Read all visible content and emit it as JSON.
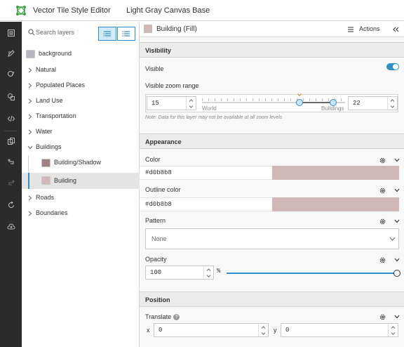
{
  "header": {
    "app_title": "Vector Tile Style Editor",
    "map_title": "Light Gray Canvas Base"
  },
  "rail": {
    "items": [
      {
        "icon": "layers-icon"
      },
      {
        "icon": "edit-icon"
      },
      {
        "icon": "quick-edit-icon"
      },
      {
        "icon": "shapes-icon"
      },
      {
        "icon": "code-icon"
      },
      {
        "icon": "copy-icon"
      },
      {
        "icon": "undo-icon"
      },
      {
        "icon": "redo-icon"
      },
      {
        "icon": "reset-icon"
      },
      {
        "icon": "save-icon"
      }
    ]
  },
  "layers": {
    "search_placeholder": "Search layers",
    "items": [
      {
        "label": "background",
        "type": "swatch",
        "swatch": "#b6b6c2"
      },
      {
        "label": "Natural",
        "type": "group"
      },
      {
        "label": "Populated Places",
        "type": "group"
      },
      {
        "label": "Land Use",
        "type": "group"
      },
      {
        "label": "Transportation",
        "type": "group"
      },
      {
        "label": "Water",
        "type": "group"
      },
      {
        "label": "Buildings",
        "type": "group-open"
      },
      {
        "label": "Building/Shadow",
        "type": "child",
        "swatch": "#9e8181"
      },
      {
        "label": "Building",
        "type": "child-selected",
        "swatch": "#d0b8b8"
      },
      {
        "label": "Roads",
        "type": "group"
      },
      {
        "label": "Boundaries",
        "type": "group"
      }
    ]
  },
  "properties": {
    "layer_title": "Building (Fill)",
    "actions_label": "Actions",
    "visibility": {
      "section": "Visibility",
      "visible_label": "Visible",
      "visible": true,
      "zoom_label": "Visible zoom range",
      "min_zoom": "15",
      "max_zoom": "22",
      "range_start": "World",
      "range_end": "Buildings",
      "slider_min_fraction": 0.683,
      "slider_max_fraction": 0.917,
      "note": "Note: Data for this layer may not be available at all zoom levels"
    },
    "appearance": {
      "section": "Appearance",
      "color_label": "Color",
      "color_value": "#d0b8b8",
      "outline_label": "Outline color",
      "outline_value": "#d0b8b8",
      "pattern_label": "Pattern",
      "pattern_value": "None",
      "opacity_label": "Opacity",
      "opacity_value": "100",
      "opacity_unit": "%"
    },
    "position": {
      "section": "Position",
      "translate_label": "Translate",
      "x_label": "x",
      "x_value": "0",
      "y_label": "y",
      "y_value": "0"
    }
  },
  "colors": {
    "accent": "#2f8fca",
    "fill": "#d0b8b8",
    "rail": "#2b2b2b",
    "logo": "#3aa540"
  }
}
